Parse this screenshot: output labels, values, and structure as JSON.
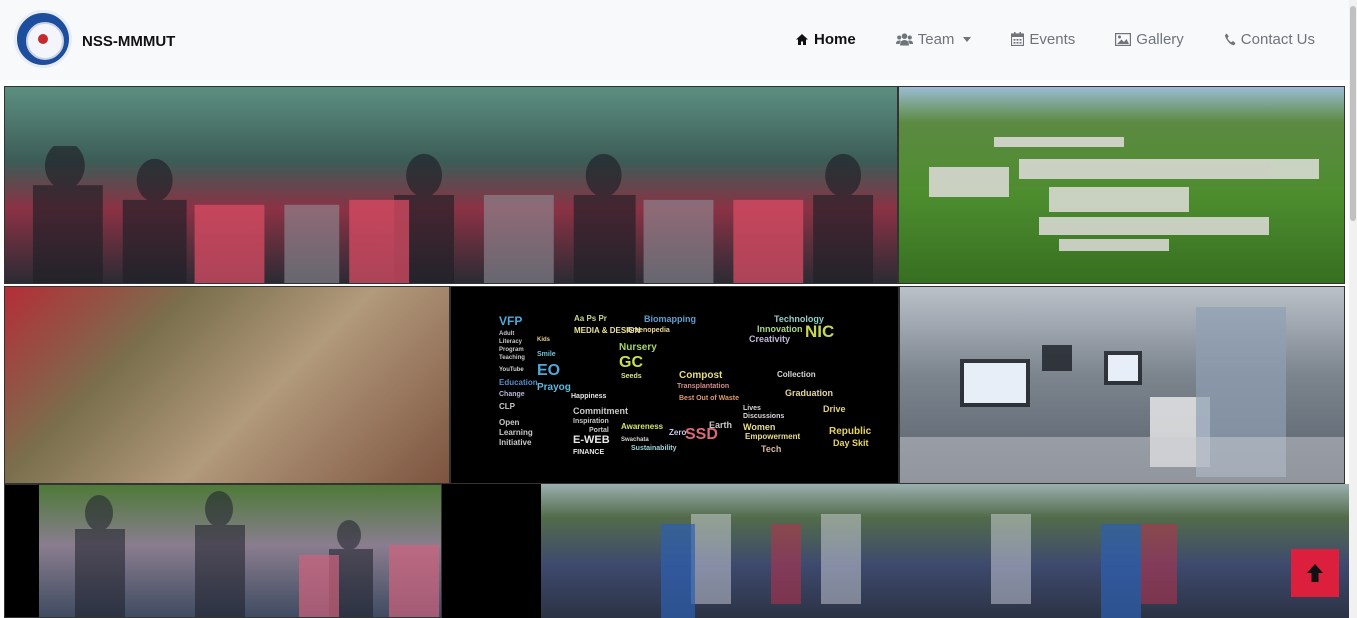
{
  "brand": {
    "name": "NSS-MMMUT",
    "logo_icon": "nss-emblem-icon"
  },
  "nav": {
    "items": [
      {
        "label": "Home",
        "icon": "home-icon",
        "active": true
      },
      {
        "label": "Team",
        "icon": "users-icon",
        "dropdown": true
      },
      {
        "label": "Events",
        "icon": "calendar-icon"
      },
      {
        "label": "Gallery",
        "icon": "image-icon"
      },
      {
        "label": "Contact Us",
        "icon": "phone-icon"
      }
    ]
  },
  "wordcloud": {
    "words": [
      "VFP",
      "Aa Ps Pr",
      "Biomapping",
      "Technology",
      "MEDIA & DESIGN",
      "Innovation",
      "NIC",
      "Creativity",
      "Adult",
      "Literacy",
      "Program",
      "Teaching",
      "Kids",
      "Smile",
      "Greenopedia",
      "Nursery",
      "EO",
      "GC",
      "Seeds",
      "Compost",
      "Transplantation",
      "Collection",
      "Graduation",
      "Prayog",
      "Happiness",
      "YouTube",
      "Education",
      "Change",
      "CLP",
      "Open",
      "Learning",
      "Initiative",
      "Commitment",
      "Inspiration",
      "Portal",
      "E-WEB",
      "FINANCE",
      "Best Out of Waste",
      "Earth",
      "Drive",
      "Lives",
      "Discussions",
      "Women",
      "Empowerment",
      "Republic",
      "Day Skit",
      "Tech",
      "Awareness",
      "Zero",
      "SSD",
      "Swachata",
      "Sustainability"
    ]
  },
  "back_to_top": {
    "icon": "arrow-up-icon"
  },
  "colors": {
    "accent": "#dc1f3c",
    "navbar_bg": "#f8f9fa"
  }
}
